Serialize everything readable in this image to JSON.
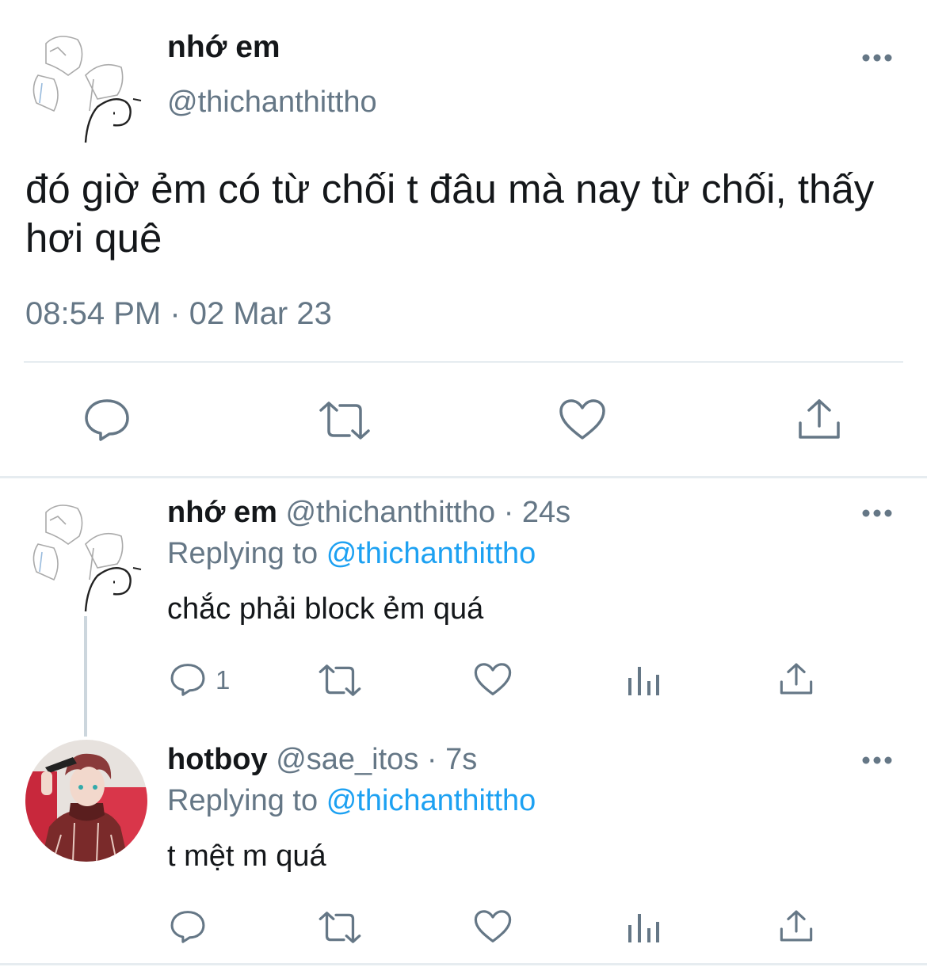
{
  "main_tweet": {
    "author_name": "nhớ em",
    "author_handle": "@thichanthittho",
    "text": "đó giờ ẻm có từ chối t đâu mà nay từ chối, thấy hơi quê",
    "timestamp": "08:54 PM · 02 Mar 23",
    "more_label": "•••"
  },
  "replies": [
    {
      "author_name": "nhớ em",
      "author_handle": "@thichanthittho",
      "age": "· 24s",
      "replying_prefix": "Replying to",
      "replying_to": "@thichanthittho",
      "text": "chắc phải block ẻm quá",
      "reply_count": "1",
      "more_label": "•••"
    },
    {
      "author_name": "hotboy",
      "author_handle": "@sae_itos",
      "age": "· 7s",
      "replying_prefix": "Replying to",
      "replying_to": "@thichanthittho",
      "text": "t mệt m quá",
      "more_label": "•••"
    }
  ],
  "icons": [
    "reply-icon",
    "retweet-icon",
    "like-icon",
    "share-icon",
    "analytics-icon",
    "more-icon"
  ],
  "colors": {
    "text": "#14171a",
    "secondary": "#657786",
    "link": "#1da1f2",
    "divider": "#e6ecf0"
  }
}
